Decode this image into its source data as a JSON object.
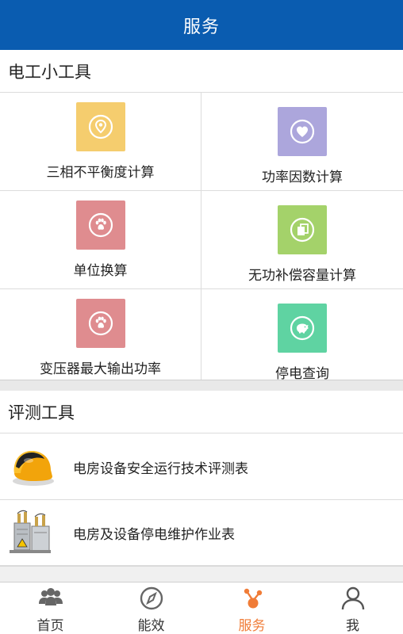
{
  "header": {
    "title": "服务"
  },
  "electrician_tools": {
    "title": "电工小工具",
    "items": [
      {
        "label": "三相不平衡度计算",
        "icon": "location-pin-icon",
        "color": "#f5cd6e"
      },
      {
        "label": "功率因数计算",
        "icon": "heart-icon",
        "color": "#aca6dc"
      },
      {
        "label": "单位换算",
        "icon": "paw-icon",
        "color": "#df8c8f"
      },
      {
        "label": "无功补偿容量计算",
        "icon": "copy-icon",
        "color": "#a4d26a"
      },
      {
        "label": "变压器最大输出功率",
        "icon": "paw-icon",
        "color": "#df8c8f"
      },
      {
        "label": "停电查询",
        "icon": "piggy-bank-icon",
        "color": "#5fd3a2"
      }
    ]
  },
  "evaluation_tools": {
    "title": "评测工具",
    "items": [
      {
        "label": "电房设备安全运行技术评测表",
        "icon": "safety-helmet-icon"
      },
      {
        "label": "电房及设备停电维护作业表",
        "icon": "electrical-equipment-icon"
      }
    ]
  },
  "tabbar": {
    "tabs": [
      {
        "label": "首页",
        "icon": "users-group-icon",
        "active": false
      },
      {
        "label": "能效",
        "icon": "compass-icon",
        "active": false
      },
      {
        "label": "服务",
        "icon": "nodes-icon",
        "active": true
      },
      {
        "label": "我",
        "icon": "person-icon",
        "active": false
      }
    ],
    "active_color": "#f07c37"
  }
}
